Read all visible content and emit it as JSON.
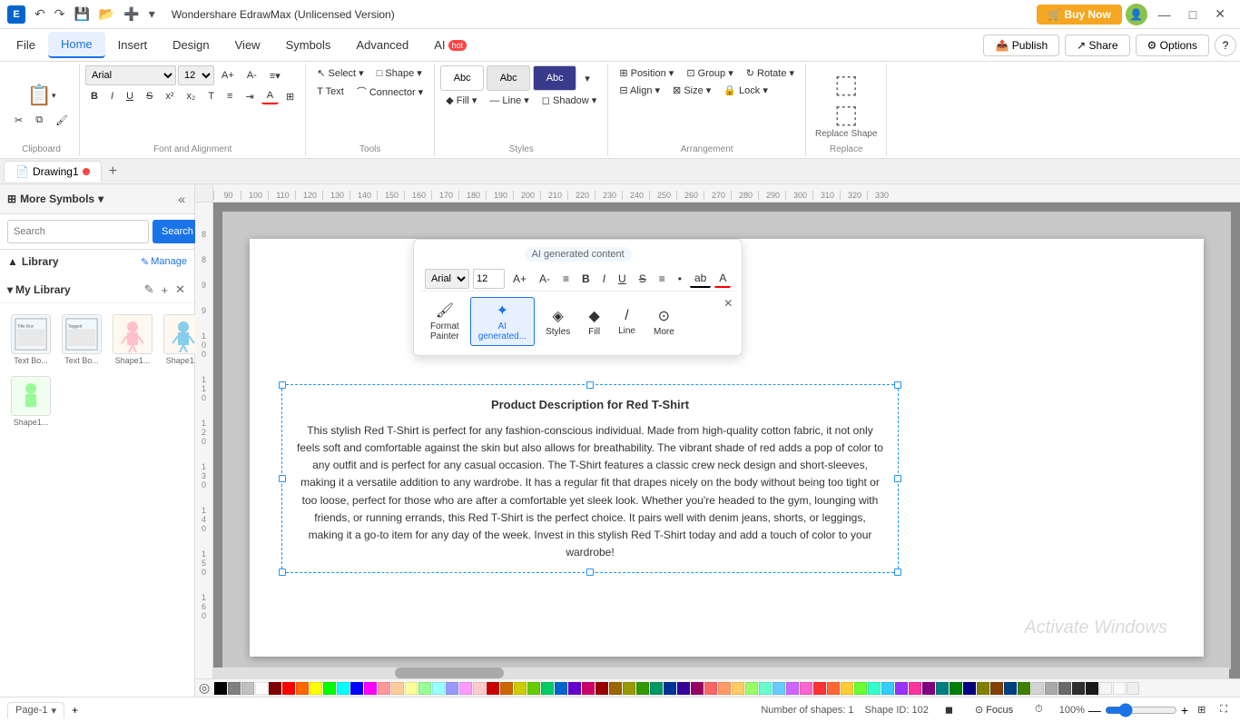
{
  "app": {
    "title": "Wondershare EdrawMax (Unlicensed Version)",
    "logo_text": "E"
  },
  "title_bar": {
    "undo_label": "↶",
    "redo_label": "↷",
    "save_label": "💾",
    "buy_now": "🛒 Buy Now",
    "minimize": "—",
    "maximize": "□",
    "close": "✕"
  },
  "menu": {
    "items": [
      "File",
      "Home",
      "Insert",
      "Design",
      "View",
      "Symbols",
      "Advanced",
      "AI"
    ],
    "active": "Home",
    "right": {
      "publish": "Publish",
      "share": "Share",
      "options": "Options",
      "help": "?"
    }
  },
  "ribbon": {
    "clipboard": {
      "title": "Clipboard",
      "paste": "Paste",
      "cut": "Cut",
      "copy": "Copy",
      "format_painter": "Format Painter"
    },
    "font": {
      "title": "Font and Alignment",
      "font_family": "Arial",
      "font_size": "12",
      "bold": "B",
      "italic": "I",
      "underline": "U",
      "strikethrough": "S",
      "superscript": "x²",
      "subscript": "x₂",
      "text": "T",
      "list": "≡",
      "indent": "⇥",
      "color": "A"
    },
    "tools": {
      "title": "Tools",
      "select": "Select ▾",
      "shape": "Shape ▾",
      "text": "Text",
      "connector": "Connector ▾"
    },
    "styles": {
      "title": "Styles",
      "fill": "Fill ▾",
      "line": "Line ▾",
      "shadow": "Shadow ▾"
    },
    "arrangement": {
      "title": "Arrangement",
      "position": "Position ▾",
      "group": "Group ▾",
      "rotate": "Rotate ▾",
      "align": "Align ▾",
      "size": "Size ▾",
      "lock": "Lock ▾"
    },
    "replace": {
      "title": "Replace",
      "replace_shape": "Replace Shape"
    }
  },
  "sidebar": {
    "title": "More Symbols",
    "search_placeholder": "Search",
    "search_btn": "Search",
    "library_label": "Library",
    "manage_label": "Manage",
    "my_library_label": "My Library",
    "shapes": [
      {
        "label": "Text Bo..."
      },
      {
        "label": "Text Bo..."
      },
      {
        "label": "Shape1..."
      },
      {
        "label": "Shape1..."
      },
      {
        "label": "Shape1..."
      }
    ]
  },
  "canvas": {
    "ruler_marks": [
      "90",
      "100",
      "110",
      "120",
      "130",
      "140",
      "150",
      "160",
      "170",
      "180",
      "190",
      "200",
      "210",
      "220",
      "230",
      "240",
      "250",
      "260",
      "270",
      "280",
      "290",
      "300",
      "310",
      "320",
      "330"
    ],
    "text_box": {
      "title": "Product Description for Red T-Shirt",
      "body": "This stylish Red T-Shirt is perfect for any fashion-conscious individual. Made from high-quality cotton fabric, it not only feels soft and comfortable against the skin but also allows for breathability. The vibrant shade of red adds a pop of color to any outfit and is perfect for any casual occasion. The T-Shirt features a classic crew neck design and short-sleeves, making it a versatile addition to any wardrobe. It has a regular fit that drapes nicely on the body without being too tight or too loose, perfect for those who are after a comfortable yet sleek look. Whether you're headed to the gym, lounging with friends, or running errands, this Red T-Shirt is the perfect choice. It pairs well with denim jeans, shorts, or leggings, making it a go-to item for any day of the week. Invest in this stylish Red T-Shirt today and add a touch of color to your wardrobe!"
    }
  },
  "ai_popup": {
    "label": "AI generated content",
    "font_family": "Arial",
    "font_size": "12",
    "tools": [
      {
        "id": "format-painter",
        "icon": "🖌",
        "label": "Format\nPainter"
      },
      {
        "id": "ai-generated",
        "icon": "✦",
        "label": "AI\ngenerated..."
      },
      {
        "id": "styles",
        "icon": "◈",
        "label": "Styles"
      },
      {
        "id": "fill",
        "icon": "◆",
        "label": "Fill"
      },
      {
        "id": "line",
        "icon": "/",
        "label": "Line"
      },
      {
        "id": "more",
        "icon": "⊙",
        "label": "More"
      }
    ],
    "font_buttons": [
      "B",
      "I",
      "U",
      "S",
      "≡",
      "•",
      "ab",
      "A"
    ]
  },
  "tab_bar": {
    "tabs": [
      {
        "label": "Drawing1",
        "active": true
      }
    ],
    "add_label": "+"
  },
  "status_bar": {
    "page_label": "Page-1",
    "shapes_count": "Number of shapes: 1",
    "shape_id": "Shape ID: 102",
    "focus_label": "Focus",
    "zoom_level": "100%"
  },
  "colors": [
    "#000000",
    "#808080",
    "#c0c0c0",
    "#ffffff",
    "#800000",
    "#ff0000",
    "#ff6600",
    "#ffff00",
    "#00ff00",
    "#00ffff",
    "#0000ff",
    "#ff00ff",
    "#ff9999",
    "#ffcc99",
    "#ffff99",
    "#99ff99",
    "#99ffff",
    "#9999ff",
    "#ff99ff",
    "#ffcccc",
    "#cc0000",
    "#cc6600",
    "#cccc00",
    "#66cc00",
    "#00cc66",
    "#0066cc",
    "#6600cc",
    "#cc0066",
    "#990000",
    "#996600",
    "#999900",
    "#339900",
    "#009966",
    "#003399",
    "#330099",
    "#990066",
    "#ff6666",
    "#ff9966",
    "#ffcc66",
    "#99ff66",
    "#66ffcc",
    "#66ccff",
    "#cc66ff",
    "#ff66cc",
    "#ff3333",
    "#ff6633",
    "#ffcc33",
    "#66ff33",
    "#33ffcc",
    "#33ccff",
    "#9933ff",
    "#ff3399",
    "#800080",
    "#008080",
    "#008000",
    "#000080",
    "#808000",
    "#804000",
    "#004080",
    "#408000",
    "#d3d3d3",
    "#a9a9a9",
    "#696969",
    "#2f2f2f",
    "#1a1a1a",
    "#f5f5f5",
    "#fafafa",
    "#eeeeee"
  ]
}
